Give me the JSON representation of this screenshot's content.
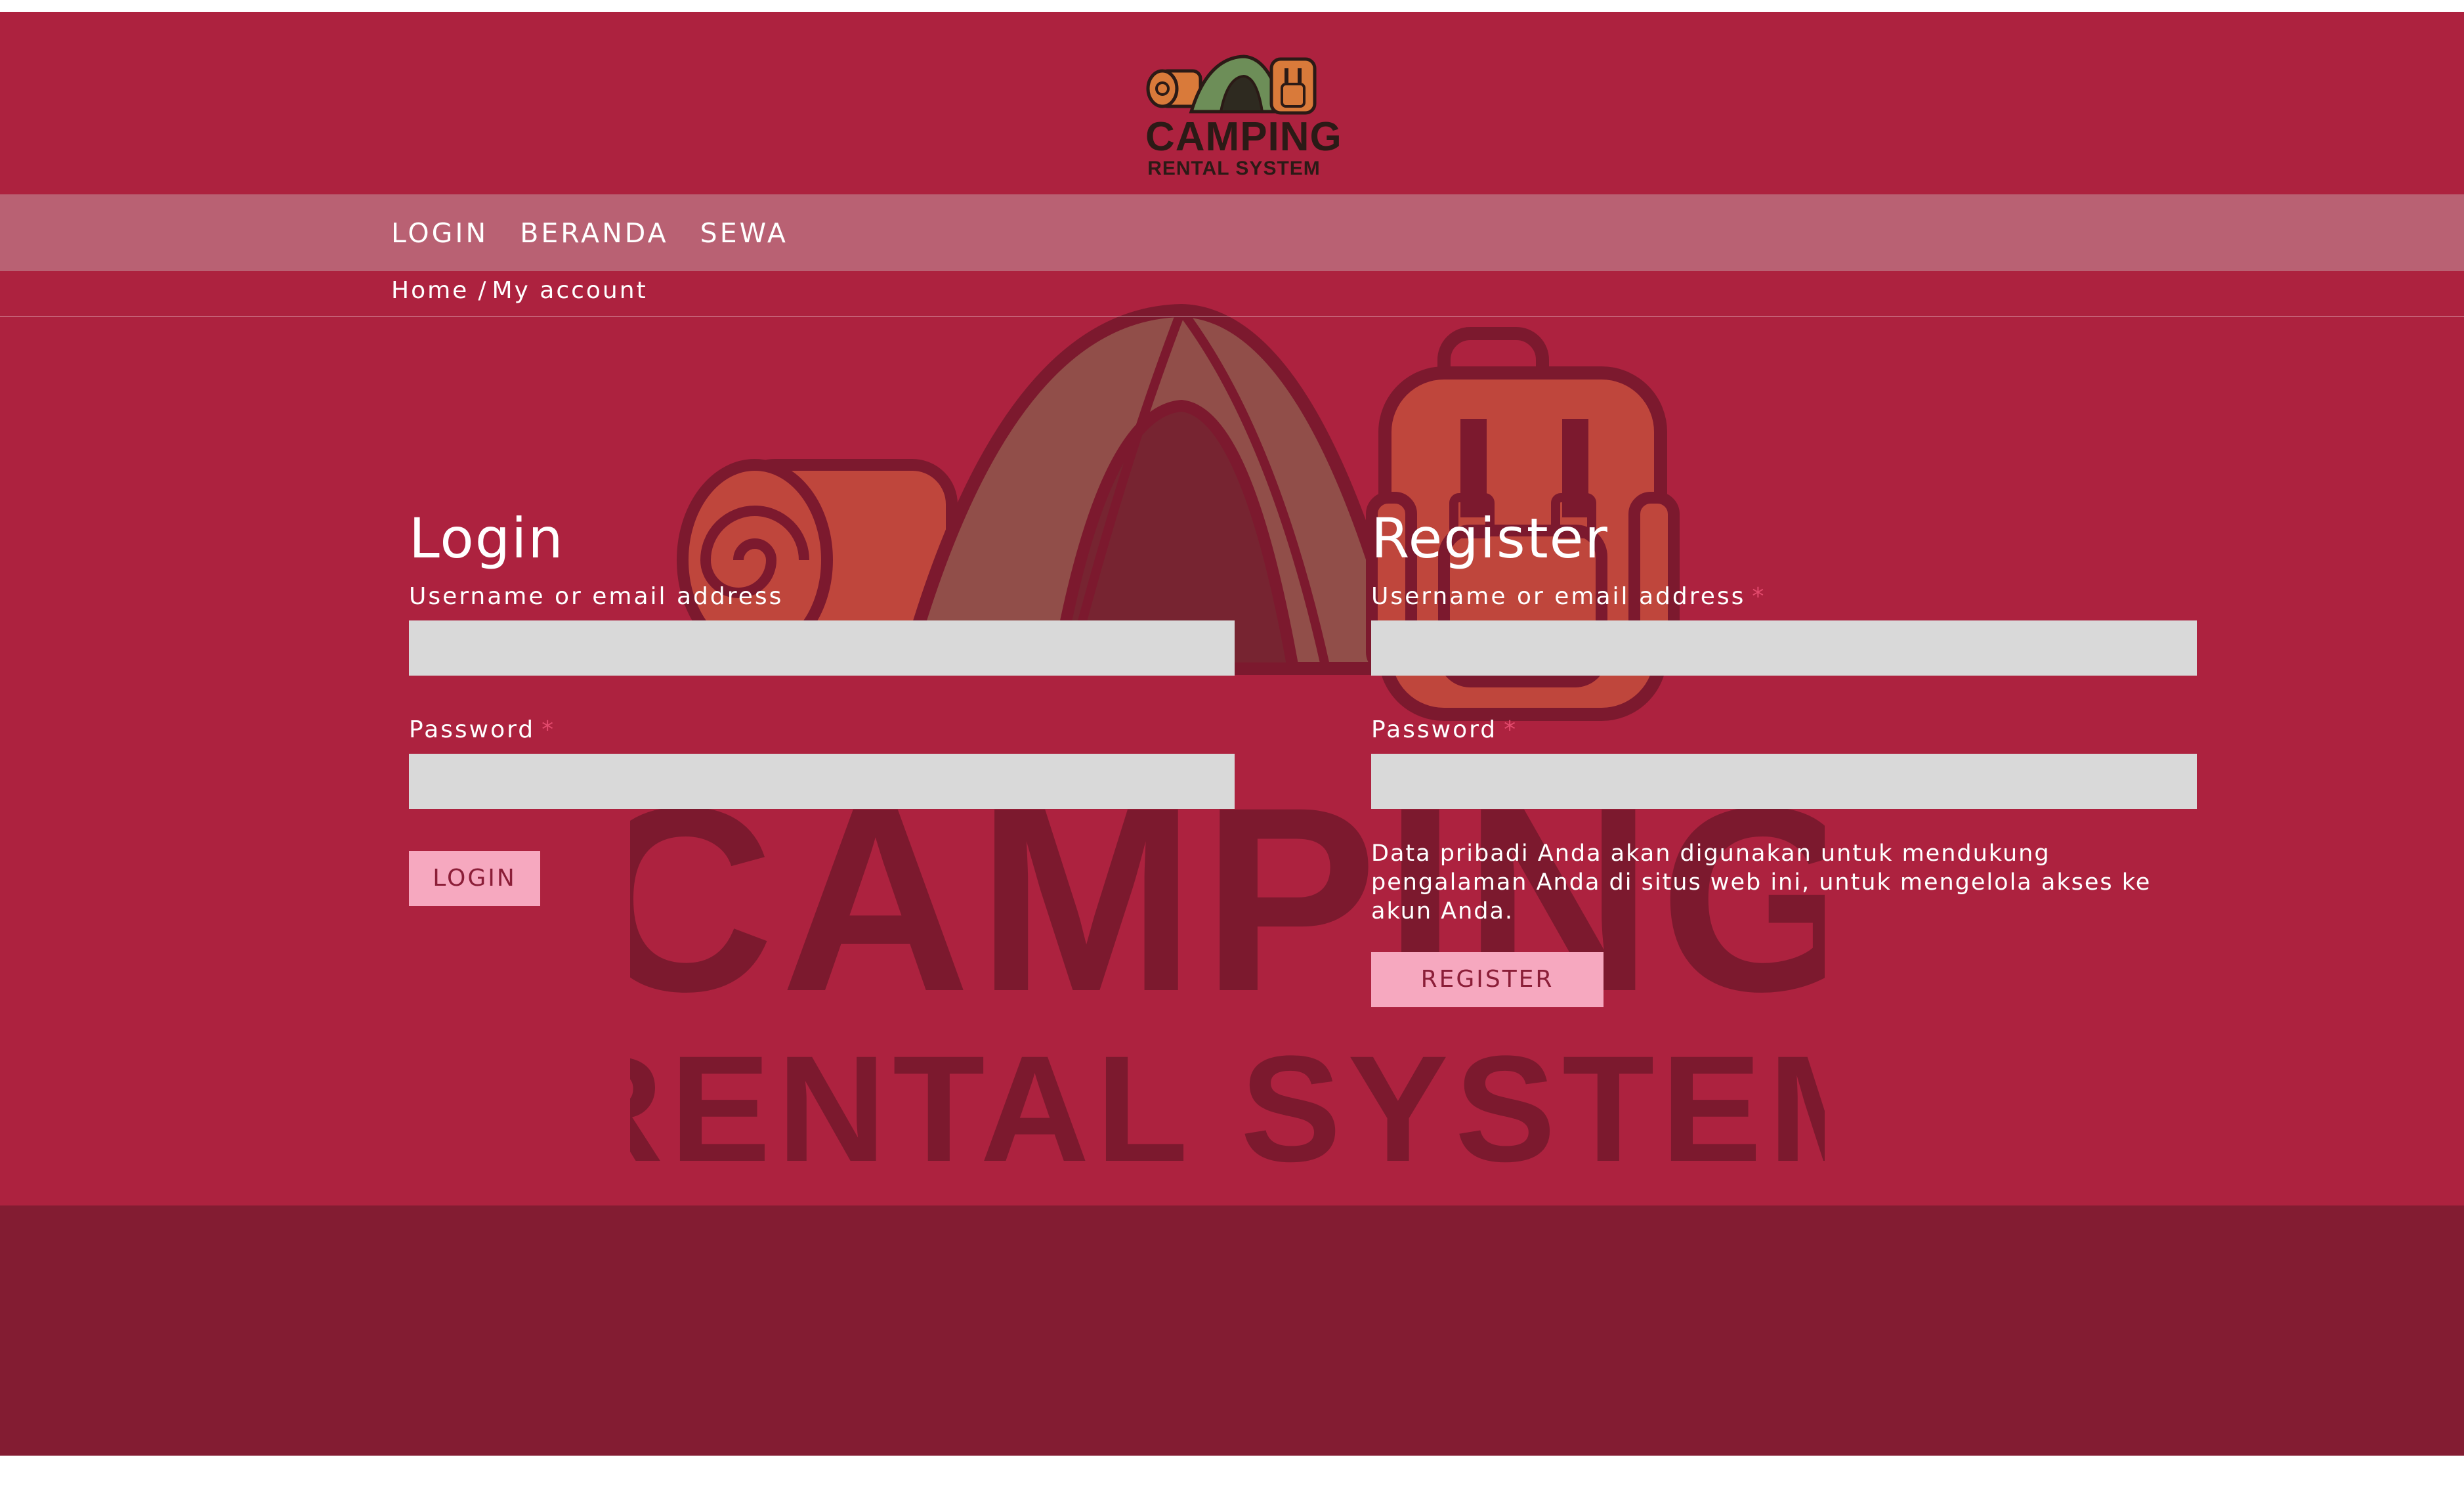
{
  "brand": {
    "logo_line1": "CAMPING",
    "logo_line2": "RENTAL SYSTEM"
  },
  "nav": {
    "items": [
      {
        "label": "LOGIN"
      },
      {
        "label": "BERANDA"
      },
      {
        "label": "SEWA"
      }
    ]
  },
  "breadcrumb": {
    "home": "Home",
    "separator": "/",
    "current": "My account"
  },
  "login": {
    "title": "Login",
    "username_label": "Username or email address",
    "username_value": "",
    "password_label": "Password",
    "password_required": "*",
    "password_value": "",
    "button": "LOGIN"
  },
  "register": {
    "title": "Register",
    "username_label": "Username or email address",
    "username_required": "*",
    "username_value": "",
    "password_label": "Password",
    "password_required": "*",
    "password_value": "",
    "privacy_text": "Data pribadi Anda akan digunakan untuk mendukung pengalaman Anda di situs web ini, untuk mengelola akses ke akun Anda.",
    "button": "REGISTER"
  },
  "colors": {
    "page_background": "#ad223f",
    "nav_band": "#b96173",
    "footer": "#831c32",
    "input_background": "#d9d9d9",
    "button_background": "#f6a8bf",
    "required_marker": "#e24a6c"
  },
  "icons": {
    "logo": "camping-tent-backpack-logo",
    "watermark": "camping-tent-backpack-watermark"
  }
}
